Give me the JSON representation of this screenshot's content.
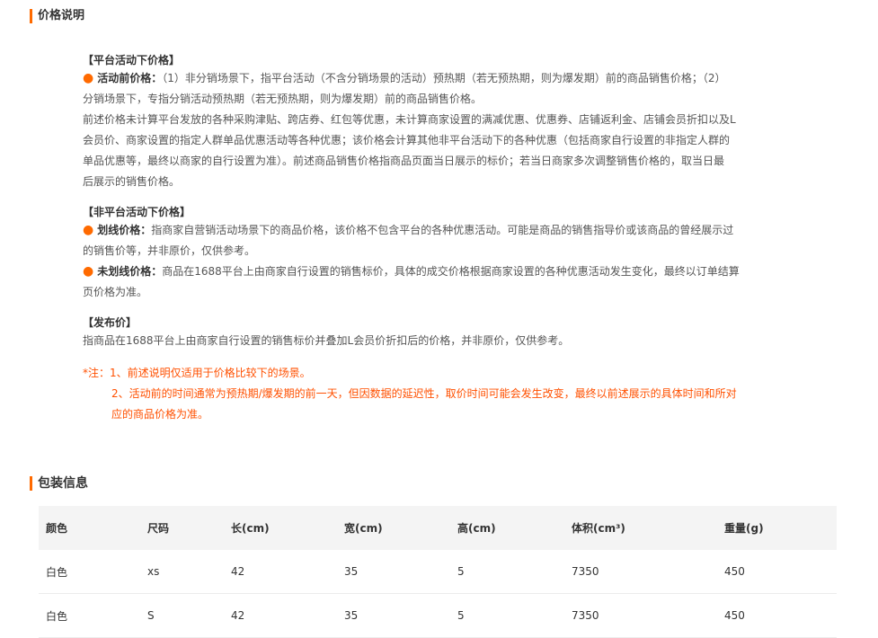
{
  "price_section": {
    "title": "价格说明",
    "platform": {
      "heading": "【平台活动下价格】",
      "pre_label": "活动前价格：",
      "lines": [
        "（1）非分销场景下，指平台活动（不含分销场景的活动）预热期（若无预热期，则为爆发期）前的商品销售价格；（2）",
        "分销场景下，专指分销活动预热期（若无预热期，则为爆发期）前的商品销售价格。",
        "前述价格未计算平台发放的各种采购津贴、跨店券、红包等优惠，未计算商家设置的满减优惠、优惠券、店铺返利金、店铺会员折扣以及L",
        "会员价、商家设置的指定人群单品优惠活动等各种优惠；该价格会计算其他非平台活动下的各种优惠（包括商家自行设置的非指定人群的",
        "单品优惠等，最终以商家的自行设置为准）。前述商品销售价格指商品页面当日展示的标价；若当日商家多次调整销售价格的，取当日最",
        "后展示的销售价格。"
      ]
    },
    "non_platform": {
      "heading": "【非平台活动下价格】",
      "strike_label": "划线价格：",
      "strike_lines": [
        "指商家自营销活动场景下的商品价格，该价格不包含平台的各种优惠活动。可能是商品的销售指导价或该商品的曾经展示过",
        "的销售价等，并非原价，仅供参考。"
      ],
      "nostrike_label": "未划线价格：",
      "nostrike_lines": [
        "商品在1688平台上由商家自行设置的销售标价，具体的成交价格根据商家设置的各种优惠活动发生变化，最终以订单结算",
        "页价格为准。"
      ]
    },
    "publish": {
      "heading": "【发布价】",
      "text": "指商品在1688平台上由商家自行设置的销售标价并叠加L会员价折扣后的价格，并非原价，仅供参考。"
    },
    "notes": {
      "prefix": "*注：",
      "lines": [
        "1、前述说明仅适用于价格比较下的场景。",
        "2、活动前的时间通常为预热期/爆发期的前一天，但因数据的延迟性，取价时间可能会发生改变，最终以前述展示的具体时间和所对",
        "应的商品价格为准。"
      ]
    }
  },
  "package_section": {
    "title": "包装信息",
    "columns": [
      "颜色",
      "尺码",
      "长(cm)",
      "宽(cm)",
      "高(cm)",
      "体积(cm³)",
      "重量(g)"
    ],
    "rows": [
      [
        "白色",
        "xs",
        "42",
        "35",
        "5",
        "7350",
        "450"
      ],
      [
        "白色",
        "S",
        "42",
        "35",
        "5",
        "7350",
        "450"
      ]
    ]
  },
  "colors": {
    "accent": "#ff6a00",
    "note": "#ff5000",
    "header_bg": "#f4f4f4"
  }
}
